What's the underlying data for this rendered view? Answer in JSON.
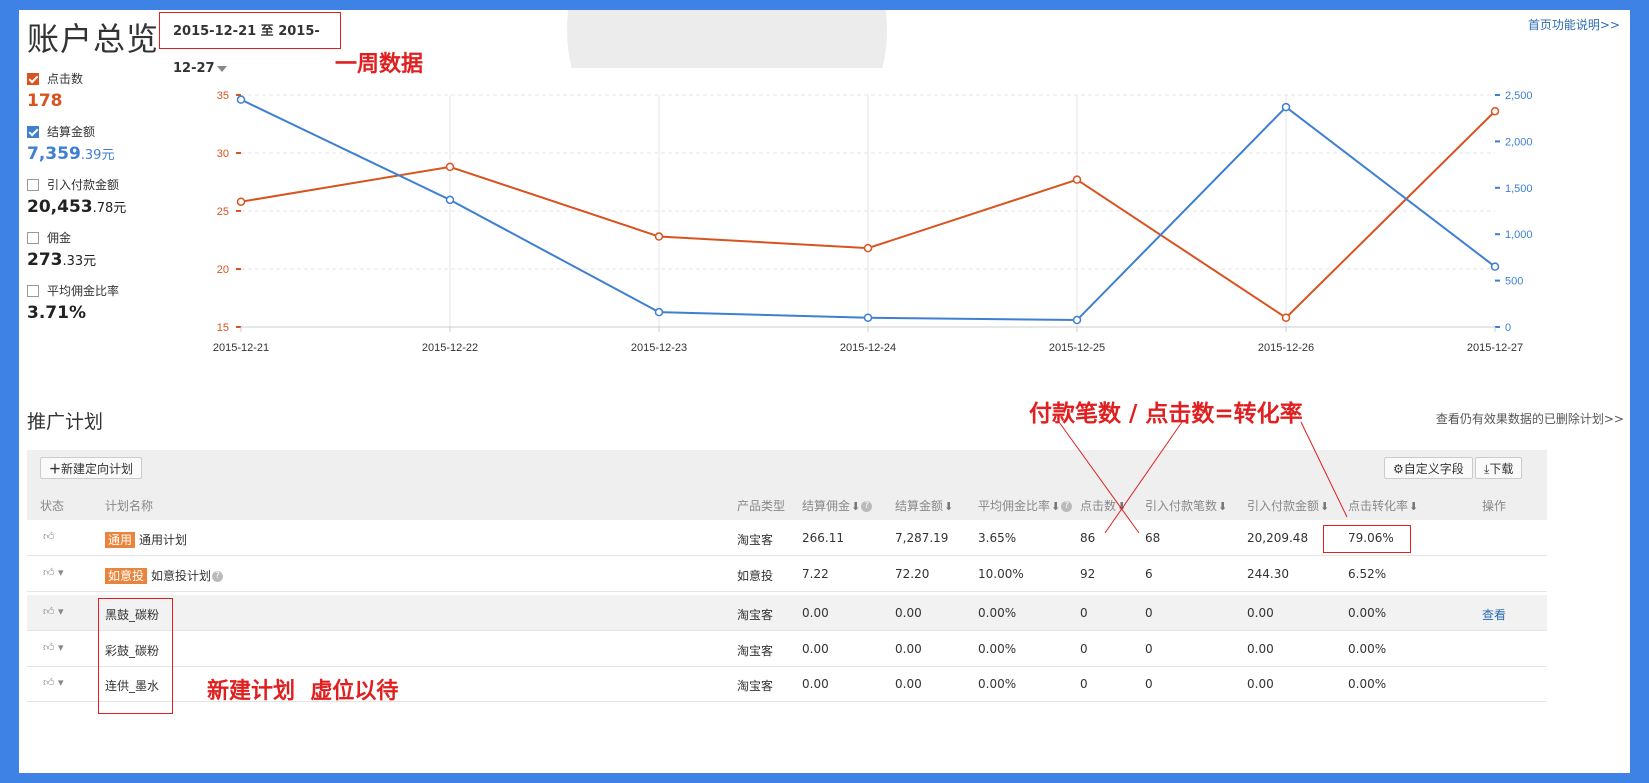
{
  "page_title": "账户总览",
  "date_range": "2015-12-21 至 2015-12-27",
  "help_link": "首页功能说明>>",
  "notes": {
    "week_data": "一周数据",
    "formula": "付款笔数 / 点击数=转化率",
    "new_plan": "新建计划  虚位以待"
  },
  "metrics": [
    {
      "label": "点击数",
      "checked": true,
      "value_main": "178",
      "value_small": "",
      "color": "#d9531e"
    },
    {
      "label": "结算金额",
      "checked": true,
      "value_main": "7,359",
      "value_small": ".39元",
      "color": "#3e7fd1"
    },
    {
      "label": "引入付款金额",
      "checked": false,
      "value_main": "20,453",
      "value_small": ".78元",
      "color": "#222222"
    },
    {
      "label": "佣金",
      "checked": false,
      "value_main": "273",
      "value_small": ".33元",
      "color": "#222222"
    },
    {
      "label": "平均佣金比率",
      "checked": false,
      "value_main": "3.71%",
      "value_small": "",
      "color": "#222222"
    }
  ],
  "chart_data": {
    "type": "line",
    "categories": [
      "2015-12-21",
      "2015-12-22",
      "2015-12-23",
      "2015-12-24",
      "2015-12-25",
      "2015-12-26",
      "2015-12-27"
    ],
    "series": [
      {
        "name": "点击数",
        "axis": "left",
        "color": "#d9531e",
        "values": [
          25.8,
          28.8,
          22.8,
          21.8,
          27.7,
          15.8,
          33.6
        ]
      },
      {
        "name": "结算金额",
        "axis": "right",
        "color": "#3e7fd1",
        "values": [
          2450,
          1370,
          160,
          100,
          75,
          2370,
          650
        ]
      }
    ],
    "y_left": {
      "range": [
        15,
        35
      ],
      "ticks": [
        "35",
        "30",
        "25",
        "20",
        "15"
      ]
    },
    "y_right": {
      "range": [
        0,
        2500
      ],
      "ticks": [
        "2,500",
        "2,000",
        "1,500",
        "1,000",
        "500",
        "0"
      ]
    },
    "grid": true
  },
  "section_title": "推广计划",
  "deleted_link": "查看仍有效果数据的已删除计划>>",
  "toolbar": {
    "new_plan_button": "新建定向计划",
    "custom_fields_button": "自定义字段",
    "download_button": "下载"
  },
  "table": {
    "headers": [
      "状态",
      "计划名称",
      "产品类型",
      "结算佣金",
      "结算金额",
      "平均佣金比率",
      "点击数",
      "引入付款笔数",
      "引入付款金额",
      "点击转化率",
      "操作"
    ],
    "rows": [
      {
        "tag": "通用",
        "name": "通用计划",
        "type": "淘宝客",
        "commission": "266.11",
        "amount": "7,287.19",
        "avg_rate": "3.65%",
        "clicks": "86",
        "orders": "68",
        "paid_amount": "20,209.48",
        "conversion": "79.06%",
        "action": ""
      },
      {
        "tag": "如意投",
        "name": "如意投计划",
        "type": "如意投",
        "commission": "7.22",
        "amount": "72.20",
        "avg_rate": "10.00%",
        "clicks": "92",
        "orders": "6",
        "paid_amount": "244.30",
        "conversion": "6.52%",
        "action": ""
      },
      {
        "tag": "",
        "name": "黑鼓_碳粉",
        "type": "淘宝客",
        "commission": "0.00",
        "amount": "0.00",
        "avg_rate": "0.00%",
        "clicks": "0",
        "orders": "0",
        "paid_amount": "0.00",
        "conversion": "0.00%",
        "action": "查看"
      },
      {
        "tag": "",
        "name": "彩鼓_碳粉",
        "type": "淘宝客",
        "commission": "0.00",
        "amount": "0.00",
        "avg_rate": "0.00%",
        "clicks": "0",
        "orders": "0",
        "paid_amount": "0.00",
        "conversion": "0.00%",
        "action": ""
      },
      {
        "tag": "",
        "name": "连供_墨水",
        "type": "淘宝客",
        "commission": "0.00",
        "amount": "0.00",
        "avg_rate": "0.00%",
        "clicks": "0",
        "orders": "0",
        "paid_amount": "0.00",
        "conversion": "0.00%",
        "action": ""
      }
    ]
  }
}
